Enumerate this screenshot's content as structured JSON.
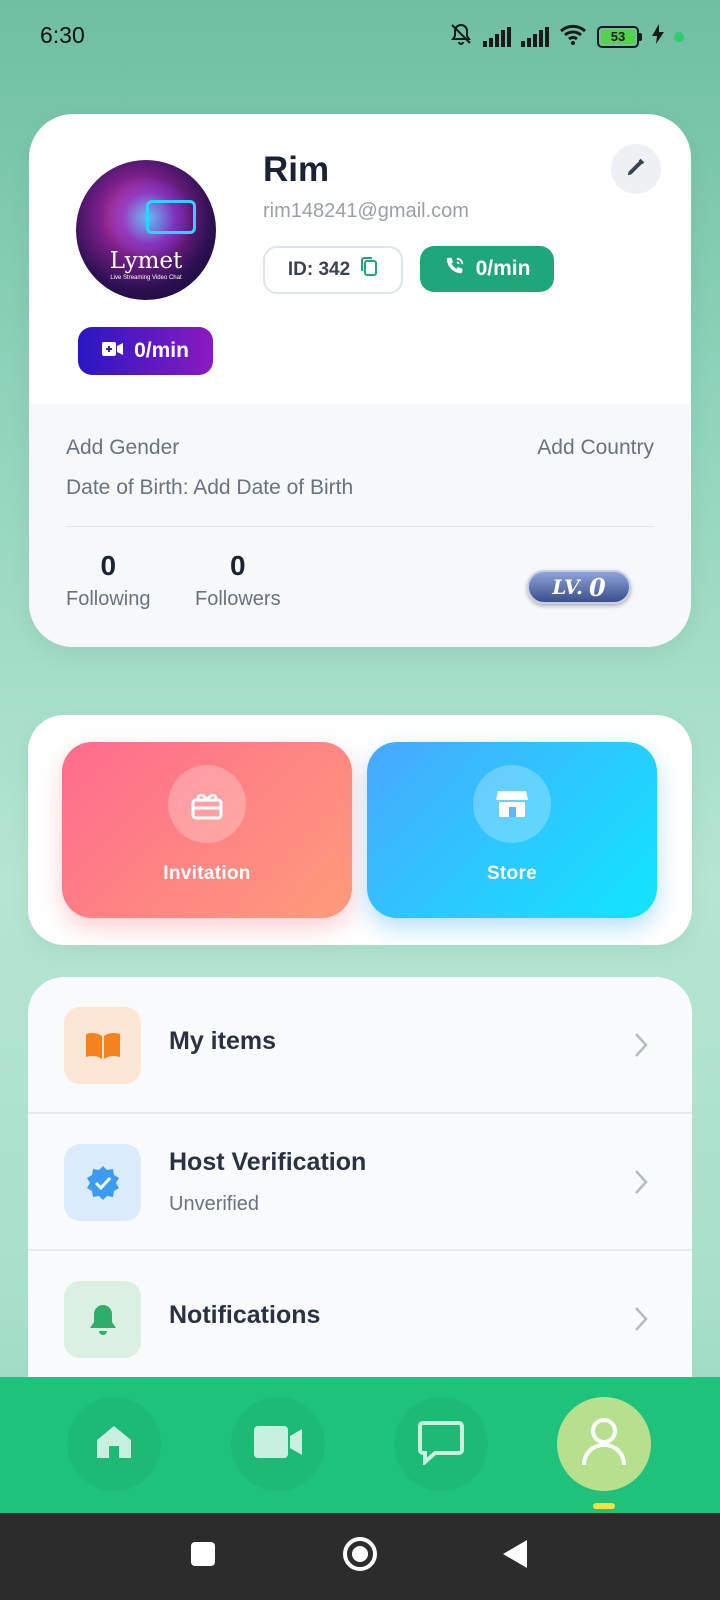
{
  "status_bar": {
    "time": "6:30",
    "battery_level": "53",
    "icons": [
      "bell-off-icon",
      "signal-icon",
      "signal-icon",
      "wifi-icon",
      "battery-icon",
      "charging-icon"
    ]
  },
  "profile": {
    "avatar_brand": "Lymet",
    "avatar_tagline": "Live Streaming Video Chat",
    "name": "Rim",
    "email": "rim148241@gmail.com",
    "id_label": "ID: 342",
    "call_rate": "0/min",
    "video_rate": "0/min",
    "gender": "Add Gender",
    "country": "Add Country",
    "date_of_birth": "Date of Birth: Add Date of Birth",
    "following_count": "0",
    "following_label": "Following",
    "followers_count": "0",
    "followers_label": "Followers",
    "level_prefix": "LV.",
    "level_value": "0"
  },
  "actions": {
    "invitation_label": "Invitation",
    "store_label": "Store"
  },
  "menu": {
    "items": [
      {
        "title": "My items",
        "subtitle": "",
        "icon": "book-icon",
        "icon_color": "#f5821f",
        "icon_bg": "#fde7d4"
      },
      {
        "title": "Host Verification",
        "subtitle": "Unverified",
        "icon": "verified-badge-icon",
        "icon_color": "#3b9cf3",
        "icon_bg": "#dcebfb"
      },
      {
        "title": "Notifications",
        "subtitle": "",
        "icon": "bell-icon",
        "icon_color": "#2fae6a",
        "icon_bg": "#dcefe3"
      }
    ]
  },
  "bottom_nav": {
    "items": [
      "home-icon",
      "video-camera-icon",
      "chat-icon",
      "profile-icon"
    ],
    "active": "profile-icon"
  },
  "colors": {
    "accent_green": "#1ec27a",
    "call_green": "#1fa67a",
    "video_purple": "#2a16c4"
  }
}
